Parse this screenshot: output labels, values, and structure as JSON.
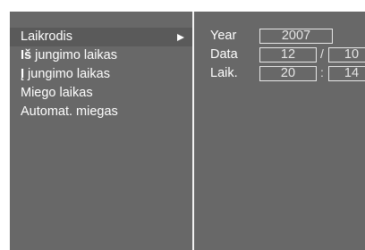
{
  "menu": {
    "items": [
      {
        "label": "Laikrodis",
        "selected": true
      },
      {
        "prefix": "Iš",
        "label": " jungimo laikas"
      },
      {
        "prefix": "Į",
        "label": " jungimo laikas"
      },
      {
        "label": "Miego laikas"
      },
      {
        "label": "Automat. miegas"
      }
    ],
    "arrow_icon": "right-triangle-icon"
  },
  "fields": {
    "year_label": "Year",
    "year_value": "2007",
    "date_label": "Data",
    "date_month": "12",
    "date_separator": "/",
    "date_day": "10",
    "time_label": "Laik.",
    "time_hour": "20",
    "time_separator": ":",
    "time_minute": "14"
  },
  "colors": {
    "background": "#686868",
    "highlight": "#5a5a5a",
    "text": "#ffffff",
    "divider": "#f2f2f2"
  }
}
